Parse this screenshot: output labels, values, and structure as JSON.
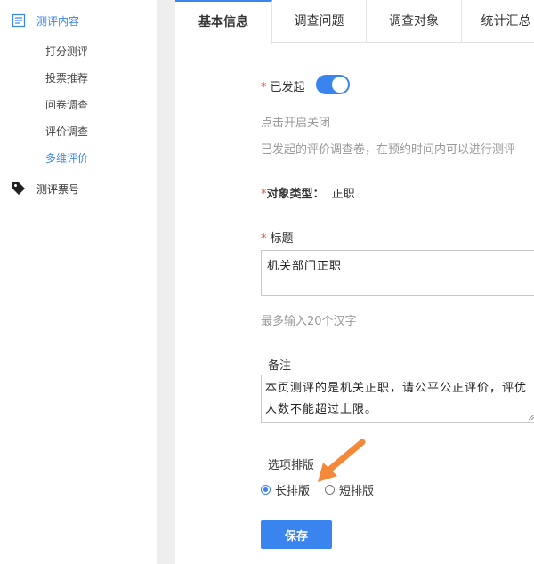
{
  "sidebar": {
    "section1": {
      "label": "测评内容",
      "icon": "list-icon"
    },
    "items": [
      {
        "label": "打分测评"
      },
      {
        "label": "投票推荐"
      },
      {
        "label": "问卷调查"
      },
      {
        "label": "评价调查"
      },
      {
        "label": "多维评价"
      }
    ],
    "section2": {
      "label": "测评票号",
      "icon": "tag-icon"
    }
  },
  "tabs": [
    {
      "label": "基本信息"
    },
    {
      "label": "调查问题"
    },
    {
      "label": "调查对象"
    },
    {
      "label": "统计汇总"
    }
  ],
  "form": {
    "launched": {
      "label": "已发起",
      "value": true,
      "hint1": "点击开启关闭",
      "hint2": "已发起的评价调查卷，在预约时间内可以进行测评"
    },
    "object_type": {
      "label": "对象类型：",
      "value": "正职"
    },
    "title": {
      "label": "标题",
      "value": "机关部门正职",
      "hint": "最多输入20个汉字"
    },
    "remark": {
      "label": "备注",
      "value": "本页测评的是机关正职，请公平公正评价，评优人数不能超过上限。"
    },
    "layout": {
      "label": "选项排版",
      "options": [
        {
          "label": "长排版",
          "checked": true
        },
        {
          "label": "短排版",
          "checked": false
        }
      ]
    },
    "save_label": "保存"
  },
  "colors": {
    "accent": "#3a84f0",
    "required": "#e94f4f",
    "annotation_arrow": "#f5893a"
  }
}
